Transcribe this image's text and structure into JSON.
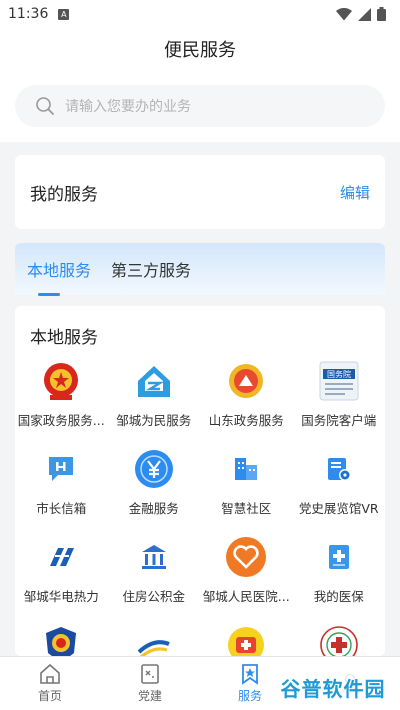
{
  "status_bar": {
    "time": "11:36",
    "a_badge": "A"
  },
  "header": {
    "title": "便民服务"
  },
  "search": {
    "placeholder": "请输入您要办的业务"
  },
  "my_services": {
    "title": "我的服务",
    "edit_label": "编辑"
  },
  "tabs": [
    {
      "label": "本地服务",
      "active": true
    },
    {
      "label": "第三方服务",
      "active": false
    }
  ],
  "local": {
    "title": "本地服务",
    "items": [
      {
        "label": "国家政务服务...",
        "icon": "national-emblem-icon"
      },
      {
        "label": "邹城为民服务",
        "icon": "house-logo-icon"
      },
      {
        "label": "山东政务服务",
        "icon": "shandong-gov-icon"
      },
      {
        "label": "国务院客户端",
        "icon": "state-council-icon"
      },
      {
        "label": "市长信箱",
        "icon": "mailbox-icon"
      },
      {
        "label": "金融服务",
        "icon": "yuan-icon"
      },
      {
        "label": "智慧社区",
        "icon": "buildings-icon"
      },
      {
        "label": "党史展览馆VR",
        "icon": "vr-exhibit-icon"
      },
      {
        "label": "邹城华电热力",
        "icon": "huadian-logo-icon"
      },
      {
        "label": "住房公积金",
        "icon": "bank-icon"
      },
      {
        "label": "邹城人民医院...",
        "icon": "hospital-heart-icon"
      },
      {
        "label": "我的医保",
        "icon": "medical-insurance-icon"
      },
      {
        "label": "",
        "icon": "police-emblem-icon"
      },
      {
        "label": "",
        "icon": "swoosh-logo-icon"
      },
      {
        "label": "",
        "icon": "medical-cross-icon"
      },
      {
        "label": "",
        "icon": "hospital-seal-icon"
      }
    ]
  },
  "bottom_nav": [
    {
      "label": "首页",
      "icon": "home-icon",
      "active": false
    },
    {
      "label": "党建",
      "icon": "party-icon",
      "active": false
    },
    {
      "label": "服务",
      "icon": "service-icon",
      "active": true
    },
    {
      "label": "",
      "icon": "person-icon",
      "active": false
    }
  ],
  "watermark": {
    "text": "谷普软件园"
  },
  "colors": {
    "accent": "#2d8cf0",
    "background": "#f3f4f6"
  }
}
